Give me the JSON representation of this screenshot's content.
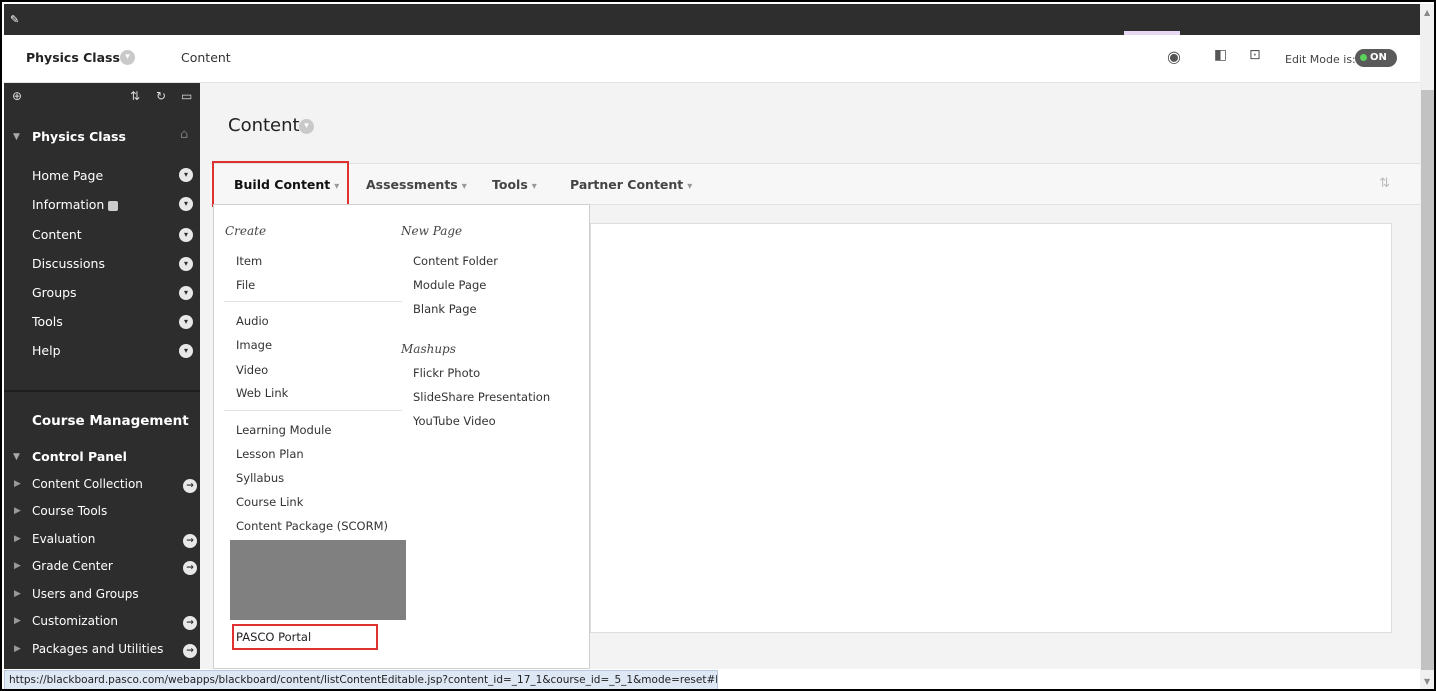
{
  "header": {
    "course_title": "Physics Class",
    "breadcrumb": "Content",
    "edit_mode_label": "Edit Mode is:",
    "edit_mode_value": "ON"
  },
  "sidebar": {
    "course_name": "Physics Class",
    "nav_items": [
      "Home Page",
      "Information",
      "Content",
      "Discussions",
      "Groups",
      "Tools",
      "Help"
    ],
    "course_management": "Course Management",
    "control_panel": "Control Panel",
    "control_items": [
      "Content Collection",
      "Course Tools",
      "Evaluation",
      "Grade Center",
      "Users and Groups",
      "Customization",
      "Packages and Utilities"
    ]
  },
  "main": {
    "page_title": "Content",
    "action_bar": [
      "Build Content",
      "Assessments",
      "Tools",
      "Partner Content"
    ]
  },
  "dropdown": {
    "create_heading": "Create",
    "create_items_1": [
      "Item",
      "File"
    ],
    "create_items_2": [
      "Audio",
      "Image",
      "Video",
      "Web Link"
    ],
    "create_items_3": [
      "Learning Module",
      "Lesson Plan",
      "Syllabus",
      "Course Link",
      "Content Package (SCORM)"
    ],
    "highlighted_item": "PASCO Portal",
    "new_page_heading": "New Page",
    "new_page_items": [
      "Content Folder",
      "Module Page",
      "Blank Page"
    ],
    "mashups_heading": "Mashups",
    "mashups_items": [
      "Flickr Photo",
      "SlideShare Presentation",
      "YouTube Video"
    ]
  },
  "status_bar": {
    "url": "https://blackboard.pasco.com/webapps/blackboard/content/listContentEditable.jsp?content_id=_17_1&course_id=_5_1&mode=reset#bcMenu"
  },
  "colors": {
    "sidebar_bg": "#2d2d2d",
    "highlight_red": "#e03131",
    "toggle_on": "#5bd35b"
  }
}
